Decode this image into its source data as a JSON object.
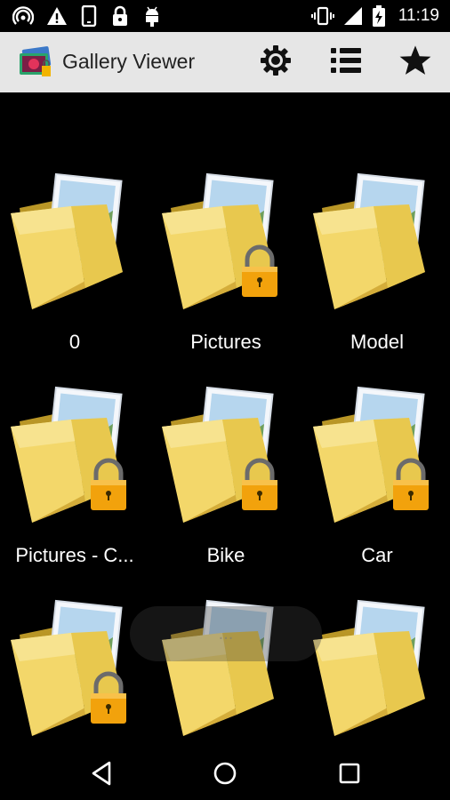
{
  "status_bar": {
    "time": "11:19",
    "left_icons": [
      "wifi-hotspot-icon",
      "warning-icon",
      "phone-icon",
      "lock-icon",
      "android-icon"
    ],
    "right_icons": [
      "vibrate-icon",
      "signal-icon",
      "battery-charging-icon"
    ]
  },
  "action_bar": {
    "title": "Gallery Viewer",
    "actions": [
      "settings-icon",
      "list-icon",
      "star-icon"
    ]
  },
  "folders": [
    {
      "label": "0",
      "locked": false
    },
    {
      "label": "Pictures",
      "locked": true
    },
    {
      "label": "Model",
      "locked": false
    },
    {
      "label": "Pictures - C...",
      "locked": true
    },
    {
      "label": "Bike",
      "locked": true
    },
    {
      "label": "Car",
      "locked": true
    },
    {
      "label": "",
      "locked": true
    },
    {
      "label": "",
      "locked": false
    },
    {
      "label": "",
      "locked": false
    }
  ],
  "watermark": "...",
  "nav_bar": [
    "back-icon",
    "home-icon",
    "recents-icon"
  ],
  "colors": {
    "action_bar": "#e6e6e6",
    "background": "#000000",
    "folder": "#e8c84e",
    "lock": "#f2a20c"
  }
}
